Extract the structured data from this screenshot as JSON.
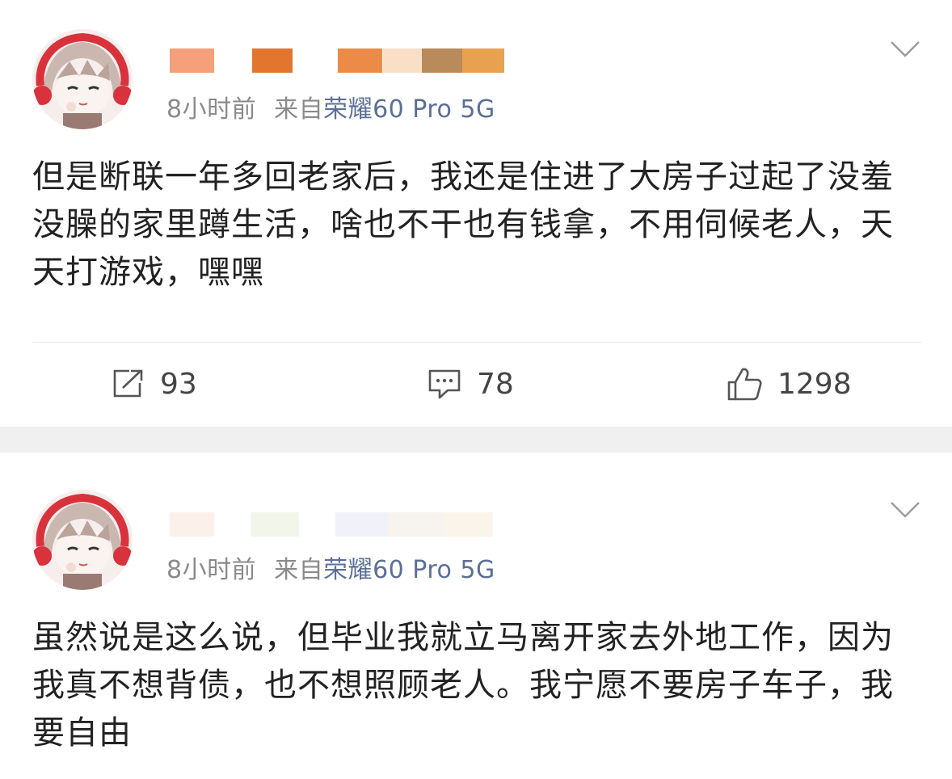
{
  "posts": [
    {
      "time": "8小时前",
      "source_prefix": "来自",
      "device": "荣耀60 Pro 5G",
      "content": "但是断联一年多回老家后，我还是住进了大房子过起了没羞没臊的家里蹲生活，啥也不干也有钱拿，不用伺候老人，天天打游戏，嘿嘿",
      "actions": {
        "repost_count": "93",
        "comment_count": "78",
        "like_count": "1298"
      },
      "icons": [
        "avatar",
        "chevron-down-icon",
        "repost-icon",
        "comment-icon",
        "like-icon"
      ]
    },
    {
      "time": "8小时前",
      "source_prefix": "来自",
      "device": "荣耀60 Pro 5G",
      "content": "虽然说是这么说，但毕业我就立马离开家去外地工作，因为我真不想背债，也不想照顾老人。我宁愿不要房子车子，我要自由",
      "icons": [
        "avatar",
        "chevron-down-icon"
      ]
    }
  ],
  "colors": {
    "meta_gray": "#8a8a8a",
    "device_link": "#5b6f98",
    "text": "#222222",
    "separator": "#f0f0f0",
    "redaction_orange": "#e2762f"
  }
}
